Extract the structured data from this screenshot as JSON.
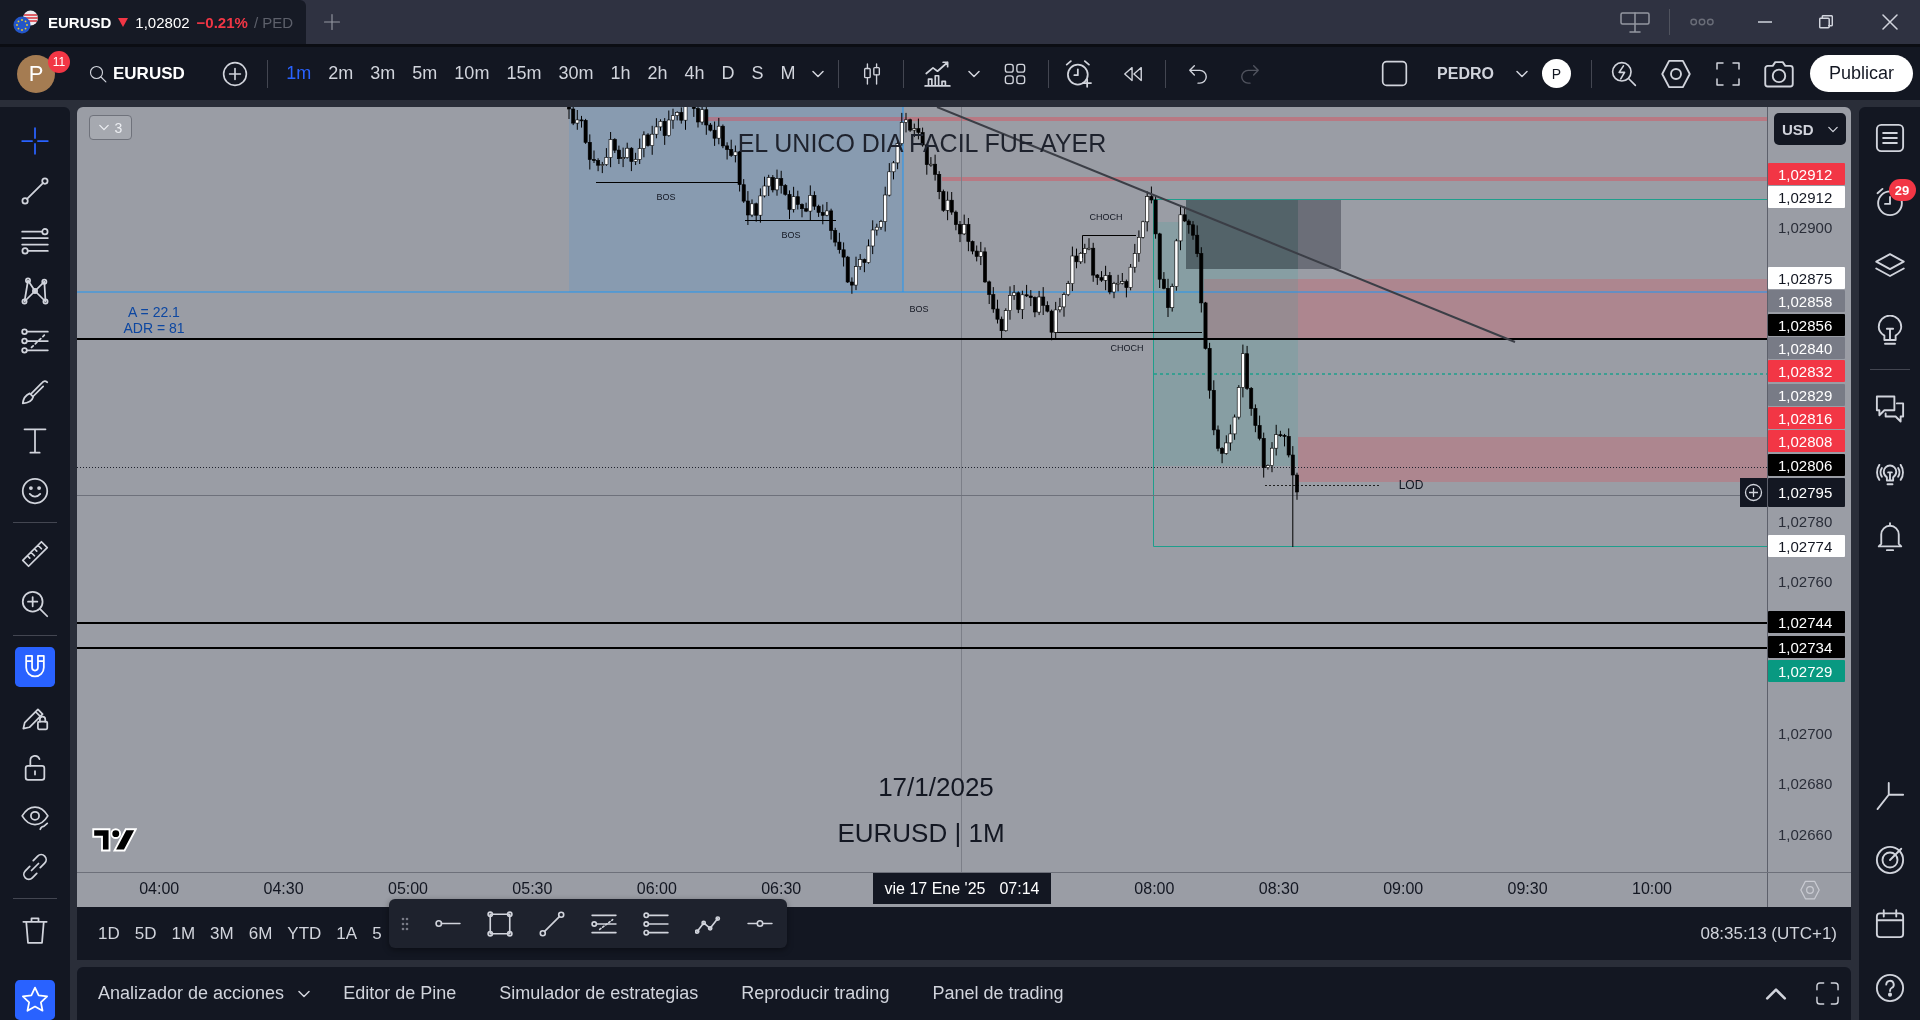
{
  "window": {
    "tab": {
      "symbol": "EURUSD",
      "price_down": true,
      "price": "1,02802",
      "change": "−0.21%",
      "layout": "/ PED"
    }
  },
  "toolbar": {
    "avatar": {
      "initial": "P",
      "badge": "11"
    },
    "symbol_search": "EURUSD",
    "intervals": [
      {
        "label": "1m",
        "selected": true
      },
      {
        "label": "2m",
        "selected": false
      },
      {
        "label": "3m",
        "selected": false
      },
      {
        "label": "5m",
        "selected": false
      },
      {
        "label": "10m",
        "selected": false
      },
      {
        "label": "15m",
        "selected": false
      },
      {
        "label": "30m",
        "selected": false
      },
      {
        "label": "1h",
        "selected": false
      },
      {
        "label": "2h",
        "selected": false
      },
      {
        "label": "4h",
        "selected": false
      },
      {
        "label": "D",
        "selected": false
      },
      {
        "label": "S",
        "selected": false
      },
      {
        "label": "M",
        "selected": false
      }
    ],
    "undo": {
      "disabled": false
    },
    "redo": {
      "disabled": true
    },
    "layout_name": "PEDRO",
    "account": {
      "initial": "P"
    },
    "publish_button": "Publicar"
  },
  "left_toolbar": {
    "drawing_tools": [
      {
        "selected": true
      },
      {
        "selected": false
      },
      {
        "selected": false
      },
      {
        "selected": false
      },
      {
        "selected": false
      },
      {
        "selected": false
      },
      {
        "selected": false
      },
      {
        "selected": false
      }
    ],
    "measure_tools": [
      {
        "selected": false
      },
      {
        "selected": false
      }
    ],
    "mode_toggles": [
      {
        "on": true
      },
      {
        "on": false
      },
      {
        "on": false
      },
      {
        "on": false
      },
      {
        "on": false
      }
    ],
    "favorites": {
      "on": true
    }
  },
  "chart": {
    "legend_toggle": {
      "count": "3"
    },
    "headline": "EL UNICO DIA FACIL FUE AYER",
    "annotations": [
      "BOS",
      "BOS",
      "BOS",
      "CHOCH",
      "CHOCH",
      "LOD"
    ],
    "indicator_values": [
      "A = 22.1",
      "ADR = 81"
    ],
    "caption": {
      "date": "17/1/2025",
      "symbol": "EURUSD | 1M"
    }
  },
  "price_axis": {
    "currency": "USD",
    "ticks": [
      "1,02900",
      "1,02780",
      "1,02760",
      "1,02700",
      "1,02680",
      "1,02660"
    ],
    "labels": [
      {
        "text": "1,02912",
        "color": "#f23645",
        "kind": "marker"
      },
      {
        "text": "1,02912",
        "color": "#ffffff",
        "kind": "marker"
      },
      {
        "text": "1,02875",
        "color": "#ffffff",
        "kind": "marker"
      },
      {
        "text": "1,02858",
        "color": "#787b86",
        "kind": "marker"
      },
      {
        "text": "1,02856",
        "color": "#000000",
        "kind": "marker"
      },
      {
        "text": "1,02840",
        "color": "#787b86",
        "kind": "marker"
      },
      {
        "text": "1,02832",
        "color": "#f23645",
        "kind": "marker"
      },
      {
        "text": "1,02829",
        "color": "#787b86",
        "kind": "marker"
      },
      {
        "text": "1,02816",
        "color": "#f23645",
        "kind": "marker"
      },
      {
        "text": "1,02808",
        "color": "#f23645",
        "kind": "marker"
      },
      {
        "text": "1,02806",
        "color": "#000000",
        "kind": "marker"
      },
      {
        "text": "1,02795",
        "color": "#131722",
        "kind": "current"
      },
      {
        "text": "1,02774",
        "color": "#ffffff",
        "kind": "marker"
      },
      {
        "text": "1,02744",
        "color": "#000000",
        "kind": "marker"
      },
      {
        "text": "1,02734",
        "color": "#000000",
        "kind": "marker"
      },
      {
        "text": "1,02729",
        "color": "#089981",
        "kind": "marker"
      }
    ]
  },
  "time_axis": {
    "ticks": [
      "04:00",
      "04:30",
      "05:00",
      "05:30",
      "06:00",
      "06:30",
      "08:00",
      "08:30",
      "09:00",
      "09:30",
      "10:00"
    ],
    "crosshair": {
      "date": "vie 17 Ene '25",
      "time": "07:14"
    }
  },
  "range_bar": {
    "ranges": [
      "1D",
      "5D",
      "1M",
      "3M",
      "6M",
      "YTD",
      "1A",
      "5"
    ],
    "clock": "08:35:13 (UTC+1)"
  },
  "right_sidebar": {
    "alerts_badge": "29"
  },
  "bottom_panel": {
    "tabs": [
      {
        "label": "Analizador de acciones",
        "kind": "menu",
        "selected": false
      },
      {
        "label": "Editor de Pine",
        "kind": "tab",
        "selected": false
      },
      {
        "label": "Simulador de estrategias",
        "kind": "tab",
        "selected": false
      },
      {
        "label": "Reproducir trading",
        "kind": "tab",
        "selected": false
      },
      {
        "label": "Panel de trading",
        "kind": "tab",
        "selected": false
      }
    ]
  }
}
